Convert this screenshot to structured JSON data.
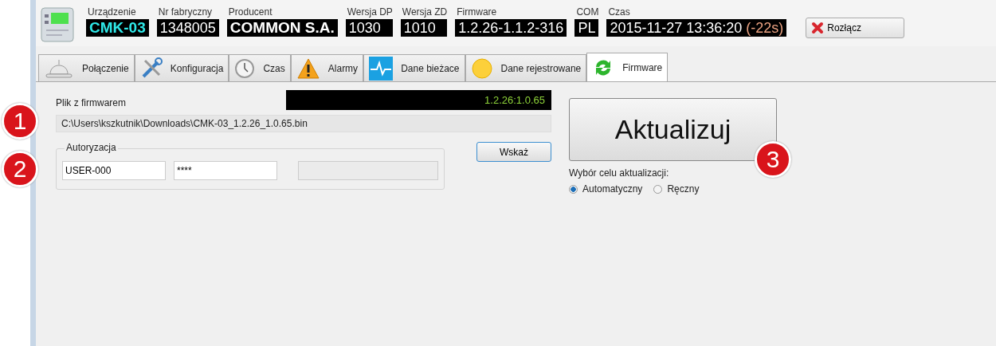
{
  "header": {
    "fields": [
      {
        "label": "Urządzenie",
        "value": "CMK-03",
        "kind": "device"
      },
      {
        "label": "Nr fabryczny",
        "value": "1348005",
        "kind": "plain"
      },
      {
        "label": "Producent",
        "value": "COMMON S.A.",
        "kind": "name"
      },
      {
        "label": "Wersja DP",
        "value": "1030",
        "kind": "plain"
      },
      {
        "label": "Wersja ZD",
        "value": "1010",
        "kind": "plain"
      },
      {
        "label": "Firmware",
        "value": "1.2.26-1.1.2-316",
        "kind": "plain"
      },
      {
        "label": "COM",
        "value": "PL",
        "kind": "plain"
      },
      {
        "label": "Czas",
        "value": "2015-11-27  13:36:20",
        "offset": "(-22s)",
        "kind": "plain"
      }
    ],
    "disconnect_button": "Rozłącz"
  },
  "tabs": [
    {
      "label": "Połączenie",
      "kind": "bell",
      "selected": false
    },
    {
      "label": "Konfiguracja",
      "kind": "tools",
      "selected": false
    },
    {
      "label": "Czas",
      "kind": "clock",
      "selected": false
    },
    {
      "label": "Alarmy",
      "kind": "warning",
      "selected": false
    },
    {
      "label": "Dane bieżace",
      "kind": "pulse",
      "selected": false
    },
    {
      "label": "Dane rejestrowane",
      "kind": "dot",
      "selected": false
    },
    {
      "label": "Firmware",
      "kind": "refresh",
      "selected": true
    }
  ],
  "firmware_file": {
    "marker": "1",
    "label": "Plik z firmwarem",
    "version": "1.2.26:1.0.65",
    "path": "C:\\Users\\kszkutnik\\Downloads\\CMK-03_1.2.26_1.0.65.bin",
    "browse_button": "Wskaż"
  },
  "authorization": {
    "marker": "2",
    "title": "Autoryzacja",
    "user": "USER-000",
    "password": "****"
  },
  "update": {
    "marker": "3",
    "button": "Aktualizuj",
    "target_label": "Wybór celu aktualizacji:",
    "targets": [
      {
        "label": "Automatyczny",
        "selected": true
      },
      {
        "label": "Ręczny",
        "selected": false
      }
    ]
  }
}
